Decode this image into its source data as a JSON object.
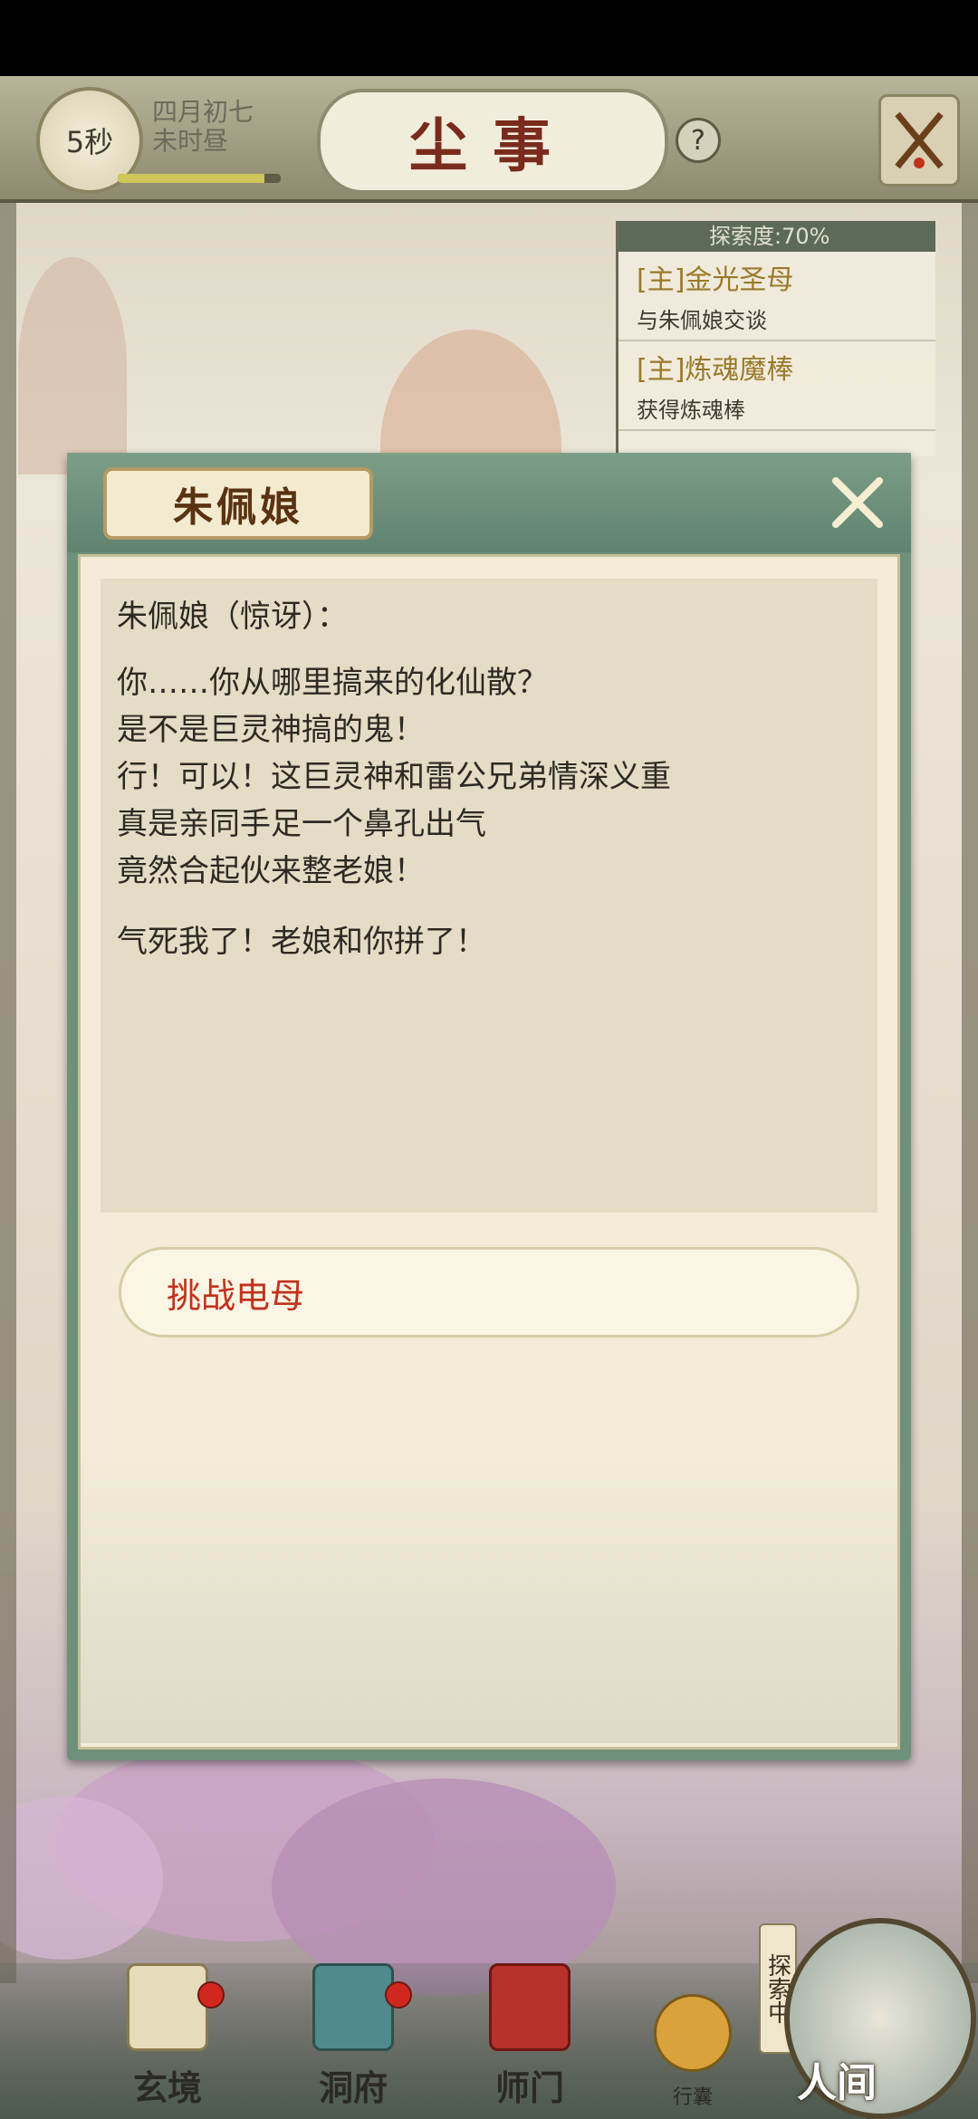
{
  "topbar": {
    "timer": "5秒",
    "date_line1": "四月初七",
    "date_line2": "未时昼",
    "title": "尘事",
    "help": "?",
    "progress_fraction": 0.9
  },
  "quests": {
    "exploration": "探索度:70%",
    "items": [
      {
        "title": "[主]金光圣母",
        "desc": "与朱佩娘交谈"
      },
      {
        "title": "[主]炼魂魔棒",
        "desc": "获得炼魂棒"
      }
    ]
  },
  "dialog": {
    "name": "朱佩娘",
    "speaker": "朱佩娘（惊讶）：",
    "lines": [
      "你……你从哪里搞来的化仙散？",
      "是不是巨灵神搞的鬼！",
      "行！可以！这巨灵神和雷公兄弟情深义重",
      "真是亲同手足一个鼻孔出气",
      "竟然合起伙来整老娘！"
    ],
    "last_line": "气死我了！老娘和你拼了！",
    "option": "挑战电母"
  },
  "nav": {
    "items": [
      {
        "label": "玄境"
      },
      {
        "label": "洞府"
      },
      {
        "label": "师门"
      },
      {
        "label": "行囊"
      }
    ],
    "explore_tag": "探索中",
    "world": "人间"
  },
  "colors": {
    "accent_red": "#c0321c",
    "panel_green": "#6f917a",
    "parchment": "#f2ecd8"
  }
}
